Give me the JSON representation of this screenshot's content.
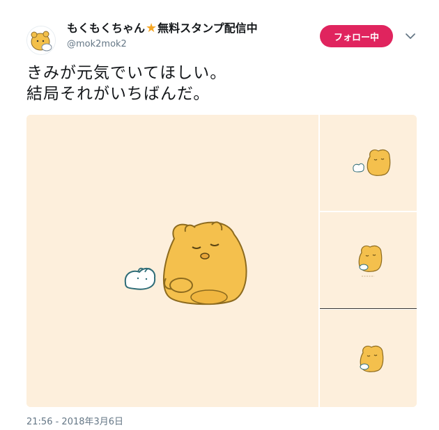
{
  "account": {
    "display_name": "もくもくちゃん",
    "star_icon": "star-icon",
    "name_suffix": "無料スタンプ配信中",
    "handle": "@mok2mok2",
    "avatar_icon": "bear-avatar-icon"
  },
  "follow_button": {
    "label": "フォロー中",
    "color": "#e0245e"
  },
  "menu": {
    "icon": "chevron-down-icon"
  },
  "tweet": {
    "lines": [
      "きみが元気でいてほしい。",
      "結局それがいちばんだ。"
    ],
    "timestamp": "21:56 - 2018年3月6日"
  },
  "media": {
    "background_color": "#fdefdc",
    "images": [
      {
        "icon": "bear-and-bunny-illustration"
      },
      {
        "icon": "bear-and-bunny-illustration"
      },
      {
        "icon": "bear-holding-bunny-illustration"
      },
      {
        "icon": "bear-holding-bunny-illustration"
      }
    ]
  }
}
